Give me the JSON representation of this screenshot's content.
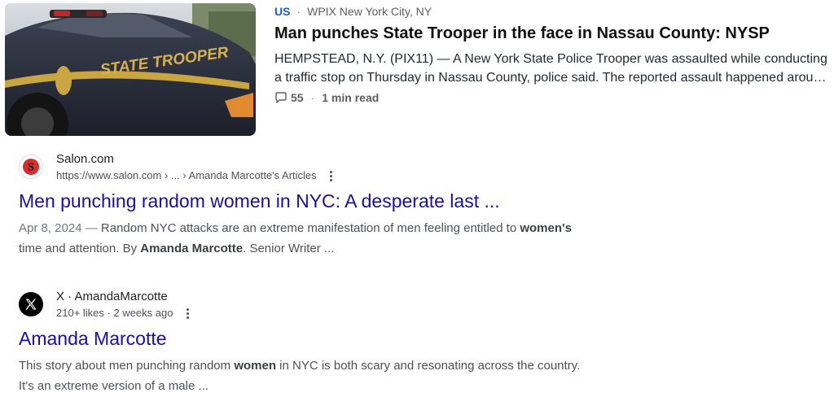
{
  "news": {
    "category": "US",
    "source": "WPIX New York City, NY",
    "title": "Man punches State Trooper in the face in Nassau County: NYSP",
    "snippet": "HEMPSTEAD, N.Y. (PIX11) — A New York State Police Trooper was assaulted while conducting a traffic stop on Thursday in Nassau County, police said. The reported assault happened arou…",
    "comments": "55",
    "read_time": "1 min read",
    "thumb_text": "STATE TROOPER",
    "thumb_icon": "police-car-photo"
  },
  "results": [
    {
      "site_name": "Salon.com",
      "url": "https://www.salon.com › ... › Amanda Marcotte's Articles",
      "title": "Men punching random women in NYC: A desperate last ...",
      "snippet_date": "Apr 8, 2024 — ",
      "snippet_parts": [
        "Random NYC attacks are an extreme manifestation of men feeling entitled to ",
        "women's",
        " time and attention. By ",
        "Amanda Marcotte",
        ". Senior Writer ..."
      ],
      "favicon_letter": "S",
      "favicon_color": "#d32f2f",
      "icon": "salon-logo-icon"
    },
    {
      "site_name": "X · AmandaMarcotte",
      "url": "210+ likes · 2 weeks ago",
      "title": "Amanda Marcotte",
      "snippet_parts": [
        "This story about men punching random ",
        "women",
        " in NYC is both scary and resonating across the country. It's an extreme version of a male ..."
      ],
      "favicon_letter": "X",
      "favicon_color": "#000000",
      "icon": "x-logo-icon"
    }
  ],
  "colors": {
    "link": "#1a0dab",
    "category": "#1a5ec6"
  }
}
